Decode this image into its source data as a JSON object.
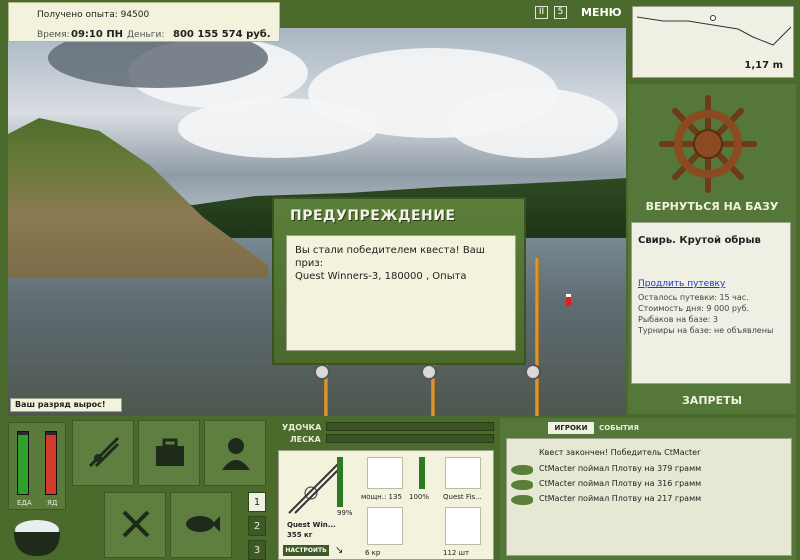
{
  "status": {
    "experience_text": "Получено опыта: 94500",
    "time_label": "Время:",
    "time_value": "09:10 ПН",
    "money_label": "Деньги:",
    "money_value": "800 155 574 руб."
  },
  "top_controls": {
    "pause_label": "II",
    "speed_label": "5",
    "menu_label": "МЕНЮ"
  },
  "depth": {
    "value": "1,17 m"
  },
  "right_panel": {
    "return_label": "ВЕРНУТЬСЯ НА БАЗУ",
    "location_name": "Свирь. Крутой обрыв",
    "extend_link": "Продлить путевку",
    "lines": [
      "Осталось путевки: 15 час.",
      "Стоимость дня: 9 000 руб.",
      "Рыбаков на базе: 3",
      "Турниры на базе: не объявлены"
    ],
    "bans_label": "ЗАПРЕТЫ"
  },
  "dialog": {
    "title": "ПРЕДУПРЕЖДЕНИЕ",
    "body_line1": "Вы стали победителем квеста! Ваш приз:",
    "body_line2": "Quest Winners-3, 180000 , Опыта"
  },
  "rank_banner": "Ваш разряд вырос!",
  "meters": {
    "food_label": "ЕДА",
    "poison_label": "ЯД",
    "food_level": 0.95,
    "poison_level": 0.95
  },
  "slot_icons": [
    "rods-icon",
    "tackle-box-icon",
    "fisherman-icon",
    "cutlery-icon",
    "fish-icon"
  ],
  "page_buttons": [
    "1",
    "2",
    "3"
  ],
  "tackle": {
    "rod_label": "УДОЧКА",
    "line_label": "ЛЕСКА",
    "rod_name": "Quest Win...",
    "rod_weight": "355 кг",
    "rod_pct": "99%",
    "configure_label": "НАСТРОИТЬ",
    "reel_detail": "мощн.: 135",
    "reel_pct": "100%",
    "line_name": "Quest Fis...",
    "hook_label": "6 кр",
    "bait_label": "112 шт"
  },
  "chat": {
    "tab_players": "ИГРОКИ",
    "tab_events": "СОБЫТИЯ",
    "messages": [
      "Квест закончен! Победитель CtMacter",
      "CtMacter поймал Плотву на 379 грамм",
      "CtMacter поймал Плотву на 316 грамм",
      "CtMacter поймал Плотву на 217 грамм"
    ]
  }
}
